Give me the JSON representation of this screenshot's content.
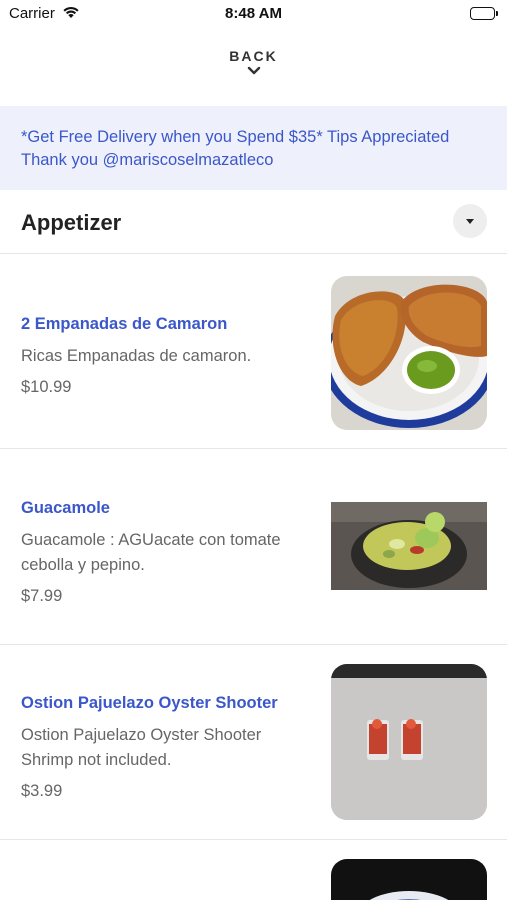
{
  "status": {
    "carrier": "Carrier",
    "time": "8:48 AM"
  },
  "nav": {
    "back_label": "BACK"
  },
  "banner": {
    "text": "*Get Free Delivery when you Spend $35* Tips Appreciated Thank you @mariscoselmazatleco"
  },
  "section": {
    "title": "Appetizer"
  },
  "items": [
    {
      "name": "2 Empanadas de Camaron",
      "description": "Ricas Empanadas de camaron.",
      "price": "$10.99"
    },
    {
      "name": "Guacamole",
      "description": "Guacamole : AGUacate con tomate cebolla y pepino.",
      "price": "$7.99"
    },
    {
      "name": "Ostion Pajuelazo Oyster Shooter",
      "description": "Ostion Pajuelazo Oyster Shooter Shrimp not included.",
      "price": "$3.99"
    }
  ],
  "colors": {
    "accent": "#3b57c9",
    "banner_bg": "#eef1fb"
  },
  "icons": [
    "wifi-icon",
    "battery-icon",
    "chevron-down-icon",
    "collapse-triangle-icon"
  ]
}
